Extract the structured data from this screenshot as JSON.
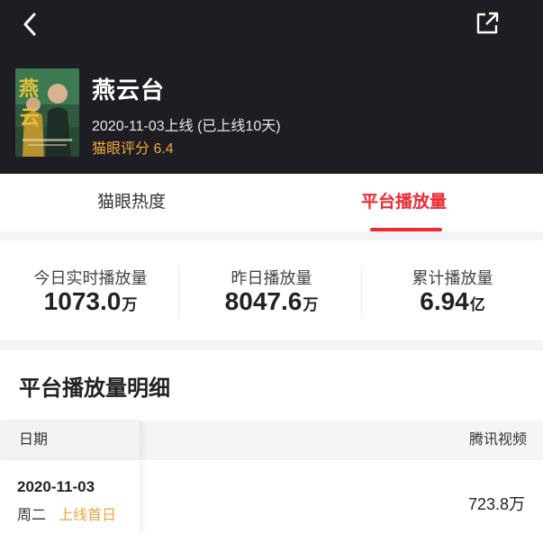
{
  "header": {
    "title": "燕云台",
    "release": "2020-11-03上线 (已上线10天)",
    "rating": "猫眼评分 6.4",
    "back_icon": "chevron-left-icon",
    "share_icon": "share-external-icon",
    "poster_text": "燕云"
  },
  "tabs": [
    {
      "label": "猫眼热度",
      "active": false
    },
    {
      "label": "平台播放量",
      "active": true
    }
  ],
  "stats": [
    {
      "label": "今日实时播放量",
      "value": "1073.0",
      "unit": "万"
    },
    {
      "label": "昨日播放量",
      "value": "8047.6",
      "unit": "万"
    },
    {
      "label": "累计播放量",
      "value": "6.94",
      "unit": "亿"
    }
  ],
  "detail": {
    "title": "平台播放量明细",
    "columns": [
      "日期",
      "腾讯视频"
    ],
    "rows": [
      {
        "date": "2020-11-03",
        "weekday": "周二",
        "badge": "上线首日",
        "value": "723.8万"
      }
    ]
  },
  "colors": {
    "header_bg": "#1f1d24",
    "accent": "#ee2b34",
    "gold": "#f0a63a"
  }
}
